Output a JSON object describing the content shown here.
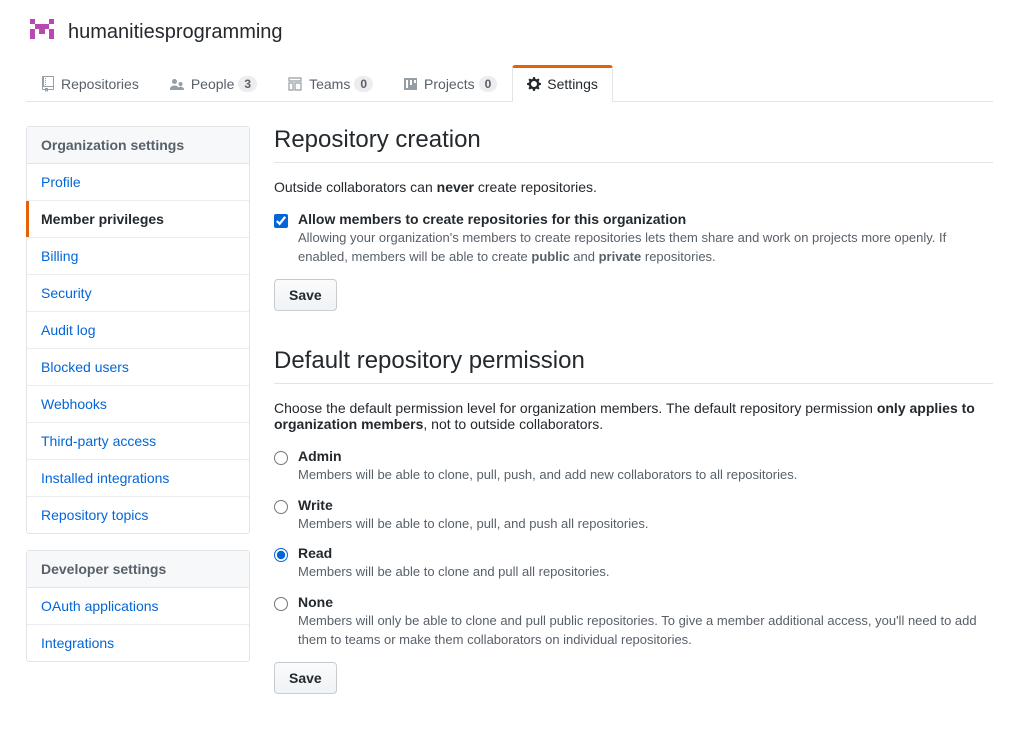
{
  "org": {
    "name": "humanitiesprogramming"
  },
  "tabs": {
    "repositories": {
      "label": "Repositories"
    },
    "people": {
      "label": "People",
      "count": "3"
    },
    "teams": {
      "label": "Teams",
      "count": "0"
    },
    "projects": {
      "label": "Projects",
      "count": "0"
    },
    "settings": {
      "label": "Settings"
    }
  },
  "sidebar": {
    "org_heading": "Organization settings",
    "org_items": [
      {
        "label": "Profile"
      },
      {
        "label": "Member privileges"
      },
      {
        "label": "Billing"
      },
      {
        "label": "Security"
      },
      {
        "label": "Audit log"
      },
      {
        "label": "Blocked users"
      },
      {
        "label": "Webhooks"
      },
      {
        "label": "Third-party access"
      },
      {
        "label": "Installed integrations"
      },
      {
        "label": "Repository topics"
      }
    ],
    "dev_heading": "Developer settings",
    "dev_items": [
      {
        "label": "OAuth applications"
      },
      {
        "label": "Integrations"
      }
    ]
  },
  "repo_creation": {
    "title": "Repository creation",
    "outside_text_pre": "Outside collaborators can ",
    "outside_text_bold": "never",
    "outside_text_post": " create repositories.",
    "allow_label": "Allow members to create repositories for this organization",
    "allow_desc_1": "Allowing your organization's members to create repositories lets them share and work on projects more openly. If enabled, members will be able to create ",
    "allow_desc_bold1": "public",
    "allow_desc_mid": " and ",
    "allow_desc_bold2": "private",
    "allow_desc_2": " repositories.",
    "save": "Save"
  },
  "default_perm": {
    "title": "Default repository permission",
    "intro_pre": "Choose the default permission level for organization members. The default repository permission ",
    "intro_bold": "only applies to organization members",
    "intro_post": ", not to outside collaborators.",
    "options": {
      "admin": {
        "label": "Admin",
        "desc": "Members will be able to clone, pull, push, and add new collaborators to all repositories."
      },
      "write": {
        "label": "Write",
        "desc": "Members will be able to clone, pull, and push all repositories."
      },
      "read": {
        "label": "Read",
        "desc": "Members will be able to clone and pull all repositories."
      },
      "none": {
        "label": "None",
        "desc": "Members will only be able to clone and pull public repositories. To give a member additional access, you'll need to add them to teams or make them collaborators on individual repositories."
      }
    },
    "save": "Save"
  }
}
